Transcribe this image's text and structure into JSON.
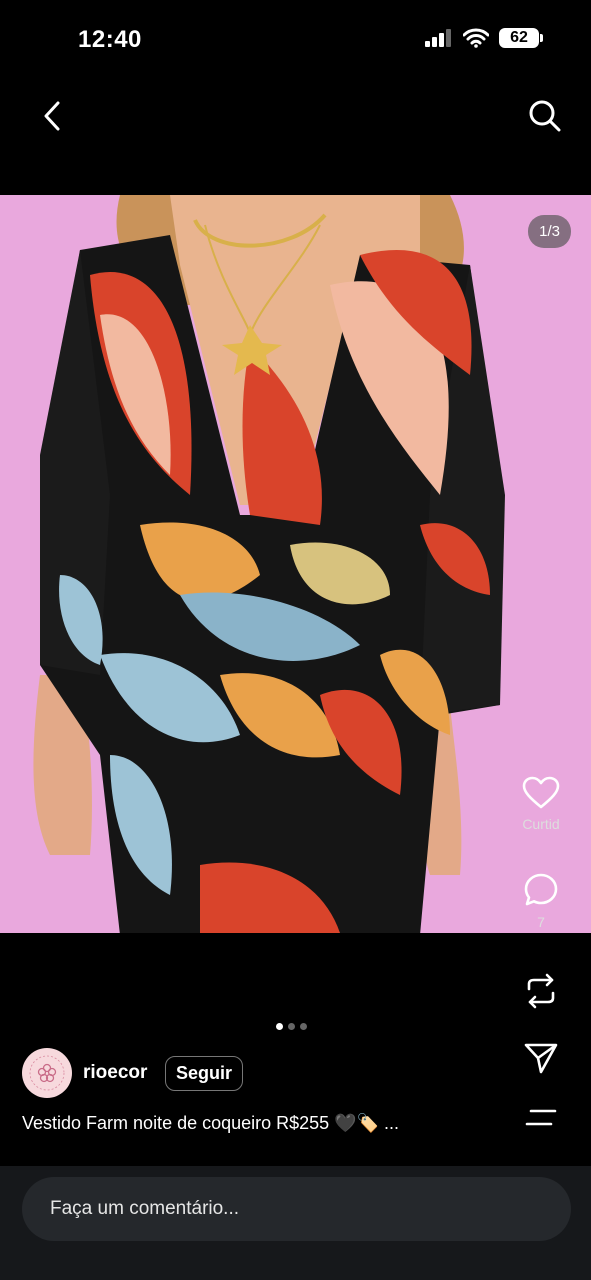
{
  "status_bar": {
    "time": "12:40",
    "battery": "62"
  },
  "nav": {
    "back_icon": "chevron-left-icon",
    "search_icon": "search-icon"
  },
  "media": {
    "page_counter": "1/3",
    "carousel": {
      "total": 3,
      "active_index": 0
    }
  },
  "actions": {
    "like_label": "Curtid",
    "comment_count": "7"
  },
  "post": {
    "username": "rioecor",
    "follow_label": "Seguir",
    "caption": "Vestido Farm noite de coqueiro R$255 🖤🏷️ ..."
  },
  "comment": {
    "placeholder": "Faça um comentário..."
  },
  "colors": {
    "background": "#000000",
    "photo_background": "#e8a9dc",
    "comment_strip": "#16181b",
    "comment_box": "#25282c"
  }
}
